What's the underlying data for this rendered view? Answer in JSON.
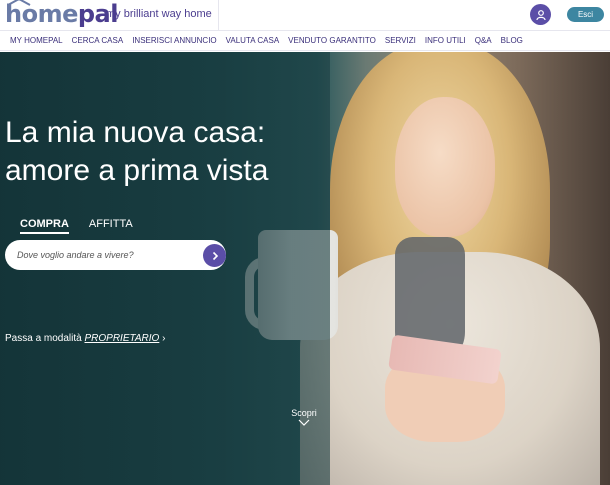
{
  "header": {
    "logo": {
      "part1": "home",
      "part2": "pal"
    },
    "tagline": "my brilliant way home",
    "user_icon": "user-icon",
    "logout_label": "Esci"
  },
  "nav": {
    "items": [
      "MY HOMEPAL",
      "CERCA CASA",
      "INSERISCI ANNUNCIO",
      "VALUTA CASA",
      "VENDUTO GARANTITO",
      "SERVIZI",
      "INFO UTILI",
      "Q&A",
      "BLOG"
    ]
  },
  "hero": {
    "headline_line1": "La mia nuova casa:",
    "headline_line2": "amore a prima vista",
    "tabs": [
      {
        "label": "COMPRA",
        "active": true
      },
      {
        "label": "AFFITTA",
        "active": false
      }
    ],
    "search": {
      "placeholder": "Dove voglio andare a vivere?",
      "button_icon": "chevron-right-icon"
    },
    "owner_link": {
      "prefix": "Passa a modalità ",
      "emphasis": "PROPRIETARIO",
      "suffix": "›"
    },
    "discover_label": "Scopri",
    "discover_icon": "chevron-down-icon"
  },
  "colors": {
    "brand_purple": "#5b4ea7",
    "logout_teal": "#3d86a1",
    "nav_text": "#3a2f7a"
  }
}
